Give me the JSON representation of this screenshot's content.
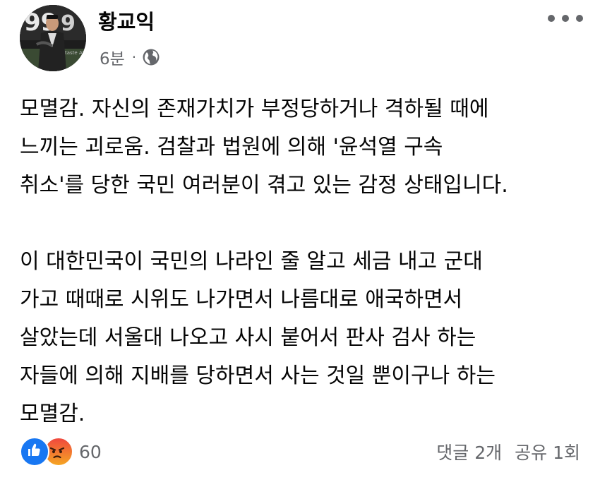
{
  "post": {
    "author": "황교익",
    "time": "6분",
    "separator": "·",
    "privacy_icon": "globe-icon",
    "more_icon": "more-horizontal-icon",
    "paragraphs": [
      "모멸감. 자신의 존재가치가 부정당하거나 격하될 때에\n느끼는 괴로움. 검찰과 법원에 의해 '윤석열 구속\n취소'를 당한 국민 여러분이 겪고 있는 감정 상태입니다.",
      "이 대한민국이 국민의 나라인 줄 알고 세금 내고 군대\n가고 때때로 시위도 나가면서 나름대로 애국하면서\n살았는데 서울대 나오고 사시 붙어서 판사 검사 하는\n자들에 의해 지배를 당하면서 사는 것일 뿐이구나 하는\n모멸감."
    ]
  },
  "footer": {
    "reaction_icons": [
      "like-icon",
      "angry-icon"
    ],
    "reaction_count": "60",
    "comments": "댓글 2개",
    "shares": "공유 1회"
  },
  "colors": {
    "like": "#1877f2",
    "angry_top": "#f0483e",
    "angry_bottom": "#f5a623",
    "secondary_text": "#65676b",
    "primary_text": "#050505"
  }
}
